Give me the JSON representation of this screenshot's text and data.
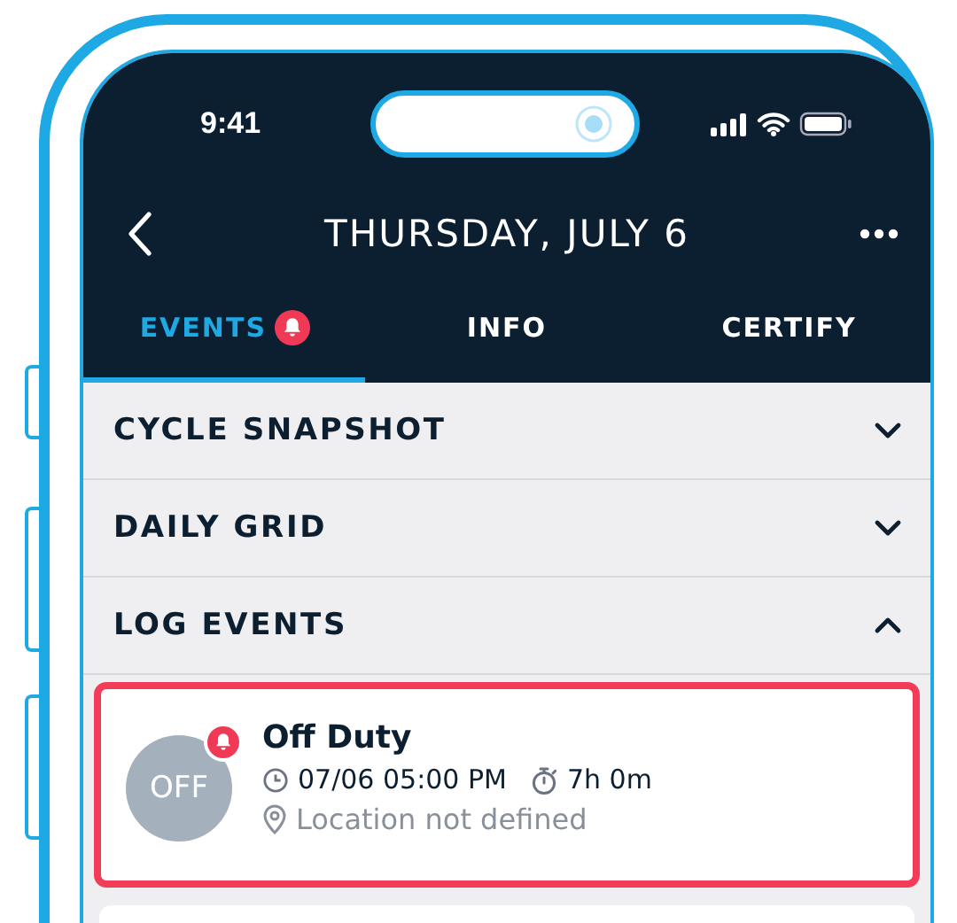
{
  "status_bar": {
    "time": "9:41"
  },
  "header": {
    "title": "THURSDAY, JULY 6"
  },
  "tabs": [
    {
      "label": "EVENTS",
      "selected": true,
      "alert": true
    },
    {
      "label": "INFO",
      "selected": false,
      "alert": false
    },
    {
      "label": "CERTIFY",
      "selected": false,
      "alert": false
    }
  ],
  "sections": [
    {
      "title": "CYCLE SNAPSHOT",
      "expanded": false
    },
    {
      "title": "DAILY GRID",
      "expanded": false
    },
    {
      "title": "LOG EVENTS",
      "expanded": true
    }
  ],
  "events": [
    {
      "status": "OFF",
      "title": "Off Duty",
      "time": "07/06 05:00 PM",
      "duration": "7h 0m",
      "location": "Location not defined",
      "alert": true,
      "flagged": true
    }
  ]
}
